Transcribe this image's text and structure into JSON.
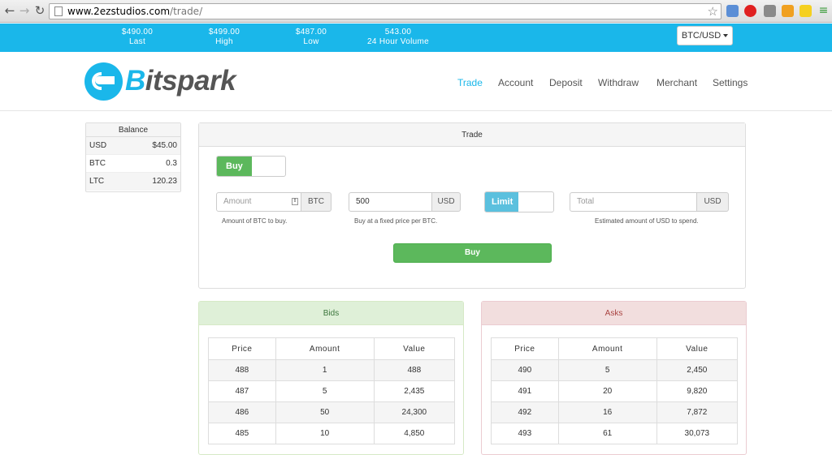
{
  "browser": {
    "url_host": "www.2ezstudios.com",
    "url_path": "/trade/"
  },
  "ticker": {
    "last_value": "$490.00",
    "last_label": "Last",
    "high_value": "$499.00",
    "high_label": "High",
    "low_value": "$487.00",
    "low_label": "Low",
    "volume_value": "543.00",
    "volume_label": "24 Hour Volume",
    "pair": "BTC/USD"
  },
  "brand": {
    "name_first": "B",
    "name_rest": "itspark"
  },
  "nav": [
    "Trade",
    "Account",
    "Deposit",
    "Withdraw",
    "Merchant",
    "Settings"
  ],
  "balance": {
    "title": "Balance",
    "rows": [
      {
        "currency": "USD",
        "amount": "$45.00"
      },
      {
        "currency": "BTC",
        "amount": "0.3"
      },
      {
        "currency": "LTC",
        "amount": "120.23"
      }
    ]
  },
  "trade": {
    "title": "Trade",
    "side_toggle": "Buy",
    "amount_placeholder": "Amount",
    "amount_unit": "BTC",
    "amount_help": "Amount of BTC to buy.",
    "price_value": "500",
    "price_unit": "USD",
    "price_help": "Buy at a fixed price per BTC.",
    "order_type_toggle": "Limit",
    "total_placeholder": "Total",
    "total_unit": "USD",
    "total_help": "Estimated amount of USD to spend.",
    "submit_label": "Buy"
  },
  "bids": {
    "title": "Bids",
    "columns": [
      "Price",
      "Amount",
      "Value"
    ],
    "rows": [
      [
        "488",
        "1",
        "488"
      ],
      [
        "487",
        "5",
        "2,435"
      ],
      [
        "486",
        "50",
        "24,300"
      ],
      [
        "485",
        "10",
        "4,850"
      ]
    ]
  },
  "asks": {
    "title": "Asks",
    "columns": [
      "Price",
      "Amount",
      "Value"
    ],
    "rows": [
      [
        "490",
        "5",
        "2,450"
      ],
      [
        "491",
        "20",
        "9,820"
      ],
      [
        "492",
        "16",
        "7,872"
      ],
      [
        "493",
        "61",
        "30,073"
      ]
    ]
  },
  "colors": {
    "accent": "#1ab7ea",
    "buy_green": "#5cb85c",
    "bids_bg": "#dff0d8",
    "asks_bg": "#f2dede"
  }
}
